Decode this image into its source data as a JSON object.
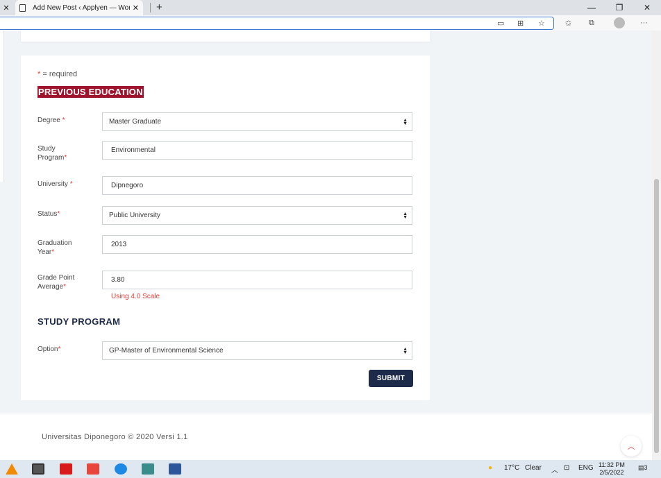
{
  "browser": {
    "tab_close_left": "✕",
    "tab_title": "Add New Post ‹ Applyen — Wor",
    "tab_close": "✕",
    "new_tab": "+",
    "win_minimize": "—",
    "win_restore": "❐",
    "win_close": "✕",
    "address_value": ""
  },
  "form": {
    "required_star": "*",
    "required_note": " = required",
    "section_previous": "PREVIOUS EDUCATION",
    "degree_label": "Degree",
    "degree_value": "Master Graduate",
    "study_program_label": "Study Program",
    "study_program_value": "Environmental",
    "university_label": "University",
    "university_value": "Dipnegoro",
    "status_label": "Status",
    "status_value": "Public University",
    "graduation_year_label": "Graduation Year",
    "graduation_year_value": "2013",
    "gpa_label": "Grade Point Average",
    "gpa_value": "3.80",
    "gpa_hint": "Using 4.0 Scale",
    "section_study": "STUDY PROGRAM",
    "option_label": "Option",
    "option_value": "GP-Master of Environmental Science",
    "star": "*",
    "submit_label": "SUBMIT"
  },
  "footer": {
    "text": "Universitas Diponegoro © 2020 Versi 1.1",
    "back_to_top": "︿"
  },
  "taskbar": {
    "weather_temp": "17°C",
    "weather_text": "Clear",
    "language": "ENG",
    "time": "11:32 PM",
    "date": "2/5/2022",
    "notification_count": "3"
  },
  "colors": {
    "accent_red": "#a0132d",
    "navy": "#1d2a4a",
    "required_red": "#e53935"
  }
}
